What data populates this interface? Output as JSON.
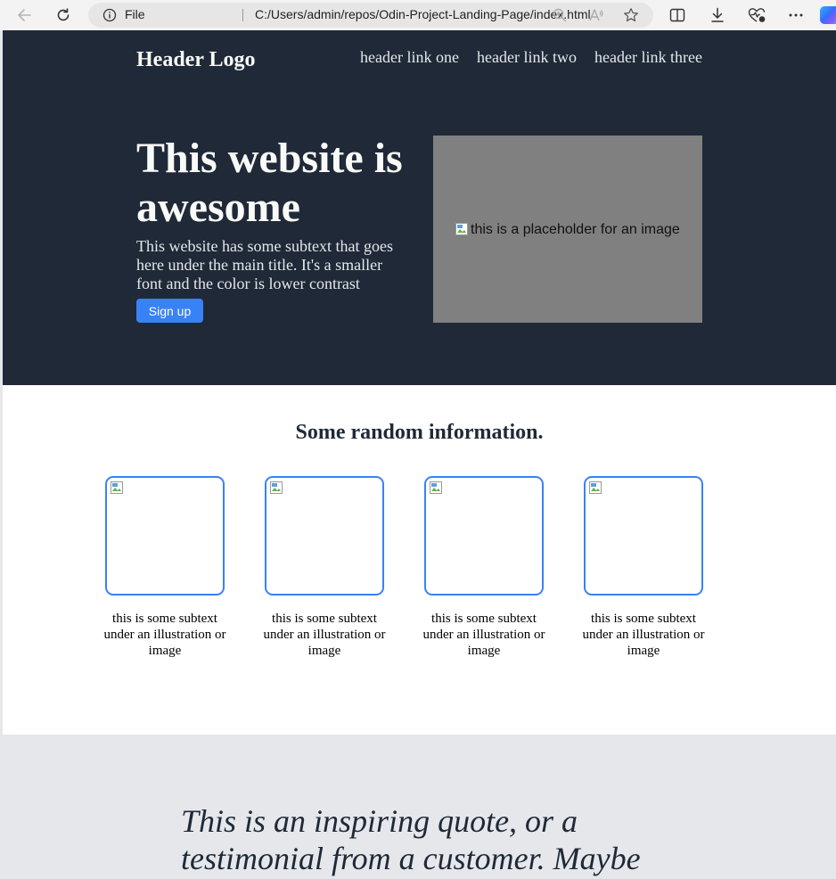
{
  "browser": {
    "info_label": "File",
    "url": "C:/Users/admin/repos/Odin-Project-Landing-Page/index.html",
    "icons": [
      "back-icon",
      "refresh-icon",
      "info-icon",
      "zoom-icon",
      "read-aloud-icon",
      "favorite-star-icon",
      "split-screen-icon",
      "downloads-icon",
      "browser-essentials-icon",
      "more-icon",
      "copilot-icon"
    ]
  },
  "header": {
    "logo": "Header Logo",
    "links": [
      "header link one",
      "header link two",
      "header link three"
    ]
  },
  "hero": {
    "title": "This website is awesome",
    "subtext": "This website has some subtext that goes here under the main title. It's a smaller font and the color is lower contrast",
    "button_label": "Sign up",
    "image_alt": "this is a placeholder for an image"
  },
  "info": {
    "title": "Some random information.",
    "cards": [
      {
        "caption": "this is some subtext under an illustration or image"
      },
      {
        "caption": "this is some subtext under an illustration or image"
      },
      {
        "caption": "this is some subtext under an illustration or image"
      },
      {
        "caption": "this is some subtext under an illustration or image"
      }
    ]
  },
  "quote": {
    "text": "This is an inspiring quote, or a testimonial from a customer. Maybe"
  },
  "colors": {
    "hero_bg": "#1f2937",
    "accent_blue": "#3882f6",
    "image_placeholder": "#808080",
    "quote_bg": "#e5e7eb"
  }
}
